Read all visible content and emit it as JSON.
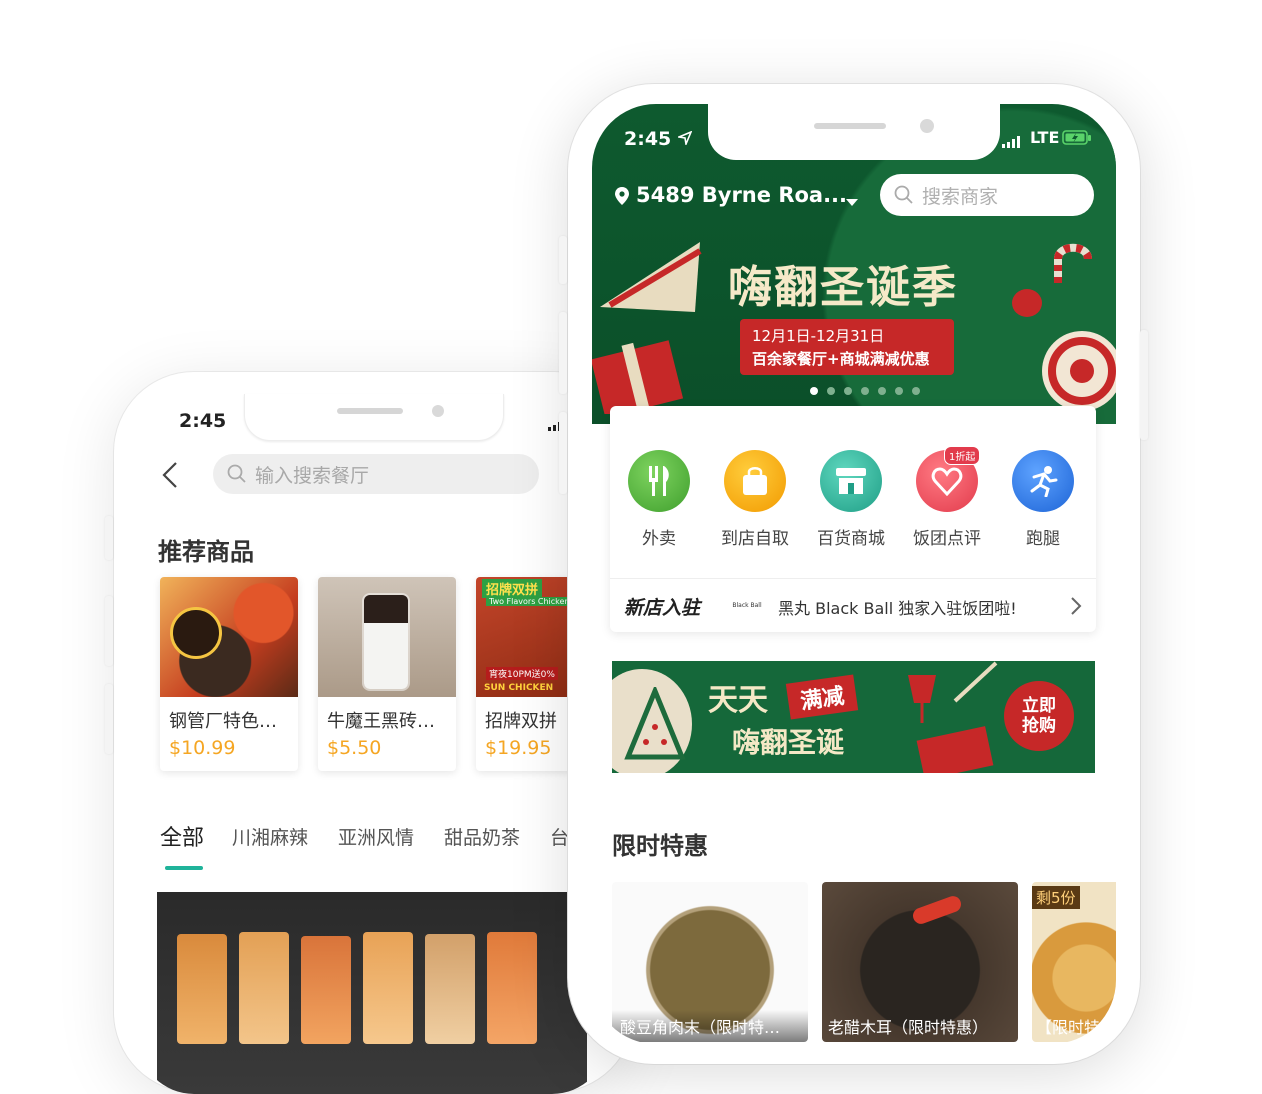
{
  "back_phone": {
    "status_time": "2:45",
    "search_placeholder": "输入搜索餐厅",
    "recommend_title": "推荐商品",
    "products": [
      {
        "name": "钢管厂特色…",
        "price": "$10.99"
      },
      {
        "name": "牛魔王黑砖…",
        "price": "$5.50"
      },
      {
        "name": "招牌双拼",
        "price": "$19.95"
      }
    ],
    "product_overlay_texts": {
      "p3_banner": "招牌双拼",
      "p3_sub": "Two Flavors Chicken",
      "p3_promo": "宵夜10PM送0%",
      "p3_brand": "SUN CHICKEN"
    },
    "categories": [
      "全部",
      "川湘麻辣",
      "亚洲风情",
      "甜品奶茶",
      "台"
    ],
    "active_category": 0
  },
  "front_phone": {
    "status_time": "2:45",
    "network": "LTE",
    "address": "5489 Byrne Roa...",
    "search_placeholder": "搜索商家",
    "banner": {
      "title": "嗨翻圣诞季",
      "date_line": "12月1日-12月31日",
      "promo_line": "百余家餐厅+商城满减优惠",
      "dots": 7,
      "active_dot": 0
    },
    "quick_icons": [
      {
        "label": "外卖",
        "icon": "fork-knife-icon",
        "color": "#4caf3c"
      },
      {
        "label": "到店自取",
        "icon": "shopping-bag-icon",
        "color": "#f5a80c"
      },
      {
        "label": "百货商城",
        "icon": "store-icon",
        "color": "#2ab39a"
      },
      {
        "label": "饭团点评",
        "icon": "heart-rating-icon",
        "color": "#f04d5d",
        "badge": "1折起"
      },
      {
        "label": "跑腿",
        "icon": "runner-icon",
        "color": "#2f7de9"
      }
    ],
    "new_store": {
      "tag": "新店入驻",
      "logo_text": "Black Ball",
      "text": "黑丸 Black Ball 独家入驻饭团啦!"
    },
    "promo_banner": {
      "line1": "天天",
      "ribbon": "满减",
      "line2": "嗨翻圣诞",
      "cta": "立即抢购"
    },
    "limited_title": "限时特惠",
    "deals": [
      {
        "name": "酸豆角肉末（限时特…"
      },
      {
        "name": "老醋木耳（限时特惠）"
      },
      {
        "name": "【限时特惠",
        "badge": "剩5份"
      }
    ]
  }
}
